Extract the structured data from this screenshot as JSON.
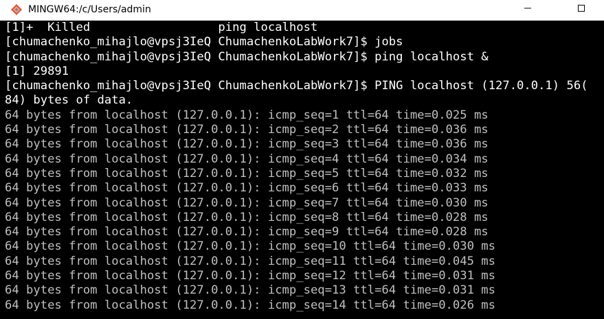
{
  "window": {
    "title": "MINGW64:/c/Users/admin",
    "colors": {
      "titlebar_bg": "#ffffff",
      "terminal_bg": "#000000",
      "text_bright": "#ffffff",
      "text_dim": "#c0c0c0"
    }
  },
  "terminal": {
    "lines": [
      {
        "text": "[1]+  Killed                  ping localhost",
        "style": "bright"
      },
      {
        "text": "[chumachenko_mihajlo@vpsj3IeQ ChumachenkoLabWork7]$ jobs",
        "style": "bright"
      },
      {
        "text": "[chumachenko_mihajlo@vpsj3IeQ ChumachenkoLabWork7]$ ping localhost &",
        "style": "bright"
      },
      {
        "text": "[1] 29891",
        "style": "bright"
      },
      {
        "text": "[chumachenko_mihajlo@vpsj3IeQ ChumachenkoLabWork7]$ PING localhost (127.0.0.1) 56(",
        "style": "bright"
      },
      {
        "text": "84) bytes of data.",
        "style": "bright"
      },
      {
        "text": "64 bytes from localhost (127.0.0.1): icmp_seq=1 ttl=64 time=0.025 ms",
        "style": "dim"
      },
      {
        "text": "64 bytes from localhost (127.0.0.1): icmp_seq=2 ttl=64 time=0.036 ms",
        "style": "dim"
      },
      {
        "text": "64 bytes from localhost (127.0.0.1): icmp_seq=3 ttl=64 time=0.036 ms",
        "style": "dim"
      },
      {
        "text": "64 bytes from localhost (127.0.0.1): icmp_seq=4 ttl=64 time=0.034 ms",
        "style": "dim"
      },
      {
        "text": "64 bytes from localhost (127.0.0.1): icmp_seq=5 ttl=64 time=0.032 ms",
        "style": "dim"
      },
      {
        "text": "64 bytes from localhost (127.0.0.1): icmp_seq=6 ttl=64 time=0.033 ms",
        "style": "dim"
      },
      {
        "text": "64 bytes from localhost (127.0.0.1): icmp_seq=7 ttl=64 time=0.030 ms",
        "style": "dim"
      },
      {
        "text": "64 bytes from localhost (127.0.0.1): icmp_seq=8 ttl=64 time=0.028 ms",
        "style": "dim"
      },
      {
        "text": "64 bytes from localhost (127.0.0.1): icmp_seq=9 ttl=64 time=0.028 ms",
        "style": "dim"
      },
      {
        "text": "64 bytes from localhost (127.0.0.1): icmp_seq=10 ttl=64 time=0.030 ms",
        "style": "dim"
      },
      {
        "text": "64 bytes from localhost (127.0.0.1): icmp_seq=11 ttl=64 time=0.045 ms",
        "style": "dim"
      },
      {
        "text": "64 bytes from localhost (127.0.0.1): icmp_seq=12 ttl=64 time=0.031 ms",
        "style": "dim"
      },
      {
        "text": "64 bytes from localhost (127.0.0.1): icmp_seq=13 ttl=64 time=0.031 ms",
        "style": "dim"
      },
      {
        "text": "64 bytes from localhost (127.0.0.1): icmp_seq=14 ttl=64 time=0.026 ms",
        "style": "dim"
      }
    ]
  },
  "icons": {
    "app": "git-diamond-icon",
    "minimize": "minimize-icon",
    "maximize": "maximize-icon"
  }
}
